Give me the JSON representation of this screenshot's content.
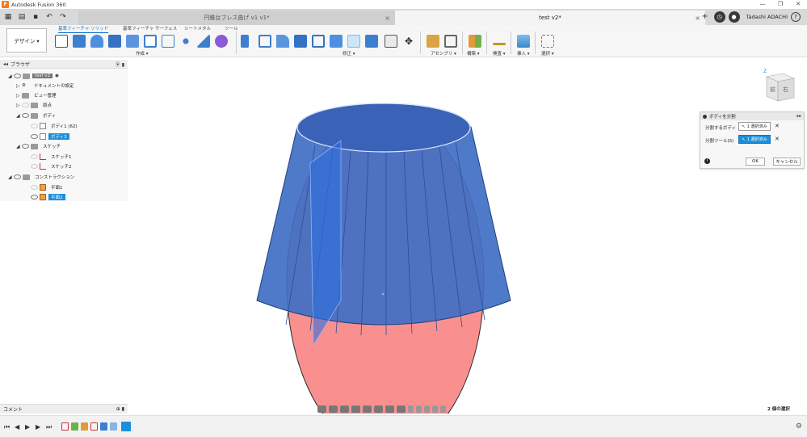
{
  "app": {
    "title": "Autodesk Fusion 360"
  },
  "tabs": [
    {
      "label": "円錐台ブレス曲げ v1 v1*",
      "close": "×"
    },
    {
      "label": "test v2*",
      "close": "×"
    }
  ],
  "user": {
    "name": "Tadashi ADACHI",
    "help": "?"
  },
  "toolbar": {
    "design_label": "デザイン ▾",
    "tabs": [
      "基準フィーチャ ソリッド",
      "基準フィーチャ サーフェス",
      "シートメタル",
      "ツール"
    ],
    "groups": [
      "作成 ▾",
      "修正 ▾",
      "アセンブリ ▾",
      "構築 ▾",
      "検査 ▾",
      "挿入 ▾",
      "選択 ▾"
    ]
  },
  "browser": {
    "title": "ブラウザ",
    "nodes": [
      {
        "label": "test v2"
      },
      {
        "label": "ドキュメントの設定"
      },
      {
        "label": "ビュー管理"
      },
      {
        "label": "原点"
      },
      {
        "label": "ボディ"
      },
      {
        "label": "ボディ1 (62)"
      },
      {
        "label": "ボディ3"
      },
      {
        "label": "スケッチ"
      },
      {
        "label": "スケッチ1"
      },
      {
        "label": "スケッチ2"
      },
      {
        "label": "コンストラクション"
      },
      {
        "label": "平面1"
      },
      {
        "label": "平面2"
      }
    ]
  },
  "comments": {
    "title": "コメント"
  },
  "dialog": {
    "title": "ボディを分割",
    "row1_label": "分割するボディ",
    "row1_value": "1 選択済み",
    "row2_label": "分割ツール(S)",
    "row2_value": "1 選択済み",
    "ok": "OK",
    "cancel": "キャンセル",
    "x": "✕"
  },
  "viewcube": {
    "front": "前",
    "right": "右",
    "axis": "Z"
  },
  "status": {
    "selection": "2 個の選択"
  },
  "colors": {
    "ellipse": "#f9908f",
    "body": "#3f6fc4",
    "accent": "#1c8fdb"
  }
}
